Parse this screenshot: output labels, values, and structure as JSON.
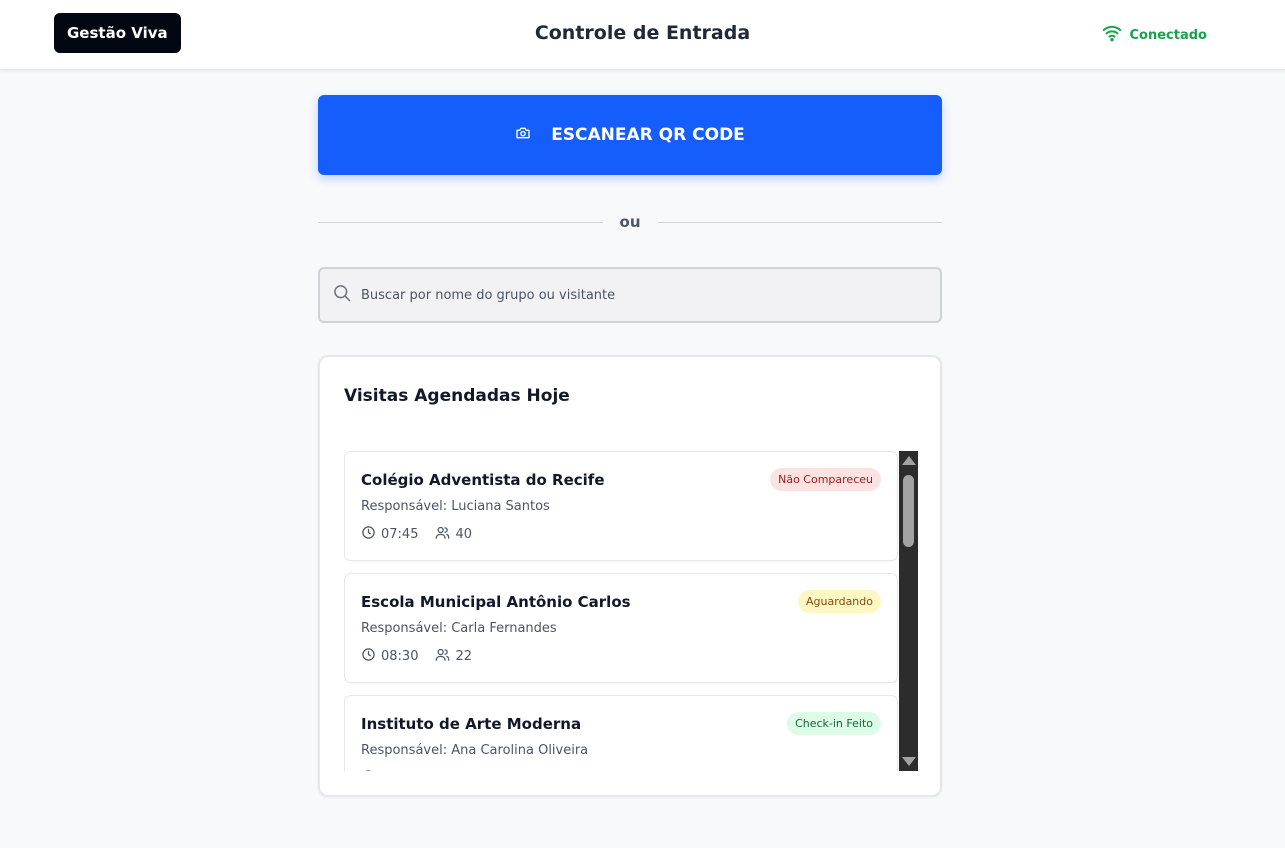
{
  "header": {
    "logo": "Gestão Viva",
    "title": "Controle de Entrada",
    "status": {
      "label": "Conectado",
      "color": "#16a34a",
      "icon": "wifi-icon"
    }
  },
  "scan": {
    "label": "ESCANEAR QR CODE",
    "icon": "camera-icon",
    "color": "#155efc"
  },
  "divider": {
    "label": "ou"
  },
  "search": {
    "placeholder": "Buscar por nome do grupo ou visitante",
    "value": "",
    "icon": "search-icon"
  },
  "visits": {
    "title": "Visitas Agendadas Hoje",
    "responsible_prefix": "Responsável: ",
    "items": [
      {
        "name": "Colégio Adventista do Recife",
        "responsible": "Luciana Santos",
        "time": "07:45",
        "people": "40",
        "status": "Não Compareceu",
        "status_color": "red"
      },
      {
        "name": "Escola Municipal Antônio Carlos",
        "responsible": "Carla Fernandes",
        "time": "08:30",
        "people": "22",
        "status": "Aguardando",
        "status_color": "yellow"
      },
      {
        "name": "Instituto de Arte Moderna",
        "responsible": "Ana Carolina Oliveira",
        "time": "",
        "people": "",
        "status": "Check-in Feito",
        "status_color": "green"
      }
    ]
  }
}
